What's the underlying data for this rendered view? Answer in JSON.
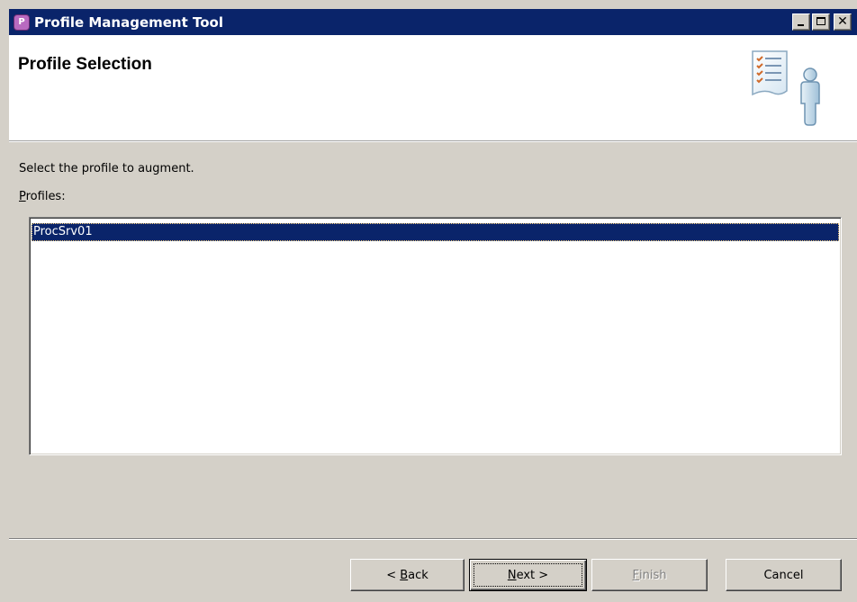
{
  "window": {
    "title": "Profile Management Tool",
    "app_icon": "profile-tool-icon"
  },
  "banner": {
    "title": "Profile Selection",
    "graphic": "checklist-person-icon"
  },
  "content": {
    "prompt": "Select the profile to augment.",
    "profiles_label_mnemonic": "P",
    "profiles_label_rest": "rofiles:",
    "profiles": [
      "ProcSrv01"
    ],
    "selected_profile": "ProcSrv01"
  },
  "buttons": {
    "back_prefix": "< ",
    "back_mnemonic": "B",
    "back_rest": "ack",
    "next_mnemonic": "N",
    "next_rest": "ext >",
    "finish_mnemonic": "F",
    "finish_rest": "inish",
    "cancel": "Cancel"
  },
  "colors": {
    "titlebar": "#0a246a",
    "selection": "#0a246a",
    "face": "#d4d0c8"
  }
}
